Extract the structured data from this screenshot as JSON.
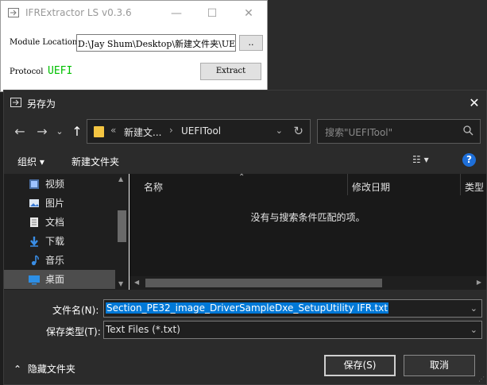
{
  "bg_window": {
    "title": "IFRExtractor LS v0.3.6",
    "module_label": "Module Location",
    "path_value": "D:\\Jay Shum\\Desktop\\新建文件夹\\UEF",
    "browse_label": "..",
    "protocol_label": "Protocol",
    "protocol_value": "UEFI",
    "extract_label": "Extract",
    "minimize": "—",
    "maximize": "☐",
    "close": "✕"
  },
  "dialog": {
    "title": "另存为",
    "close": "✕",
    "nav": {
      "back": "←",
      "forward": "→",
      "recent": "⌄",
      "up": "↑",
      "breadcrumb_prefix": "«",
      "crumb1": "新建文...",
      "crumb_sep": "›",
      "crumb2": "UEFITool",
      "search_placeholder": "搜索\"UEFITool\"",
      "refresh": "↻",
      "dropdown": "⌄"
    },
    "toolbar": {
      "organize": "组织 ▾",
      "new_folder": "新建文件夹",
      "view": "☷ ▾",
      "help": "?"
    },
    "nav_pane": {
      "items": [
        {
          "label": "视频",
          "icon": "video-icon"
        },
        {
          "label": "图片",
          "icon": "pictures-icon"
        },
        {
          "label": "文档",
          "icon": "documents-icon"
        },
        {
          "label": "下载",
          "icon": "download-icon"
        },
        {
          "label": "音乐",
          "icon": "music-icon"
        },
        {
          "label": "桌面",
          "icon": "desktop-icon"
        }
      ]
    },
    "file_pane": {
      "columns": [
        "名称",
        "修改日期",
        "类型"
      ],
      "empty_message": "没有与搜索条件匹配的项。"
    },
    "bottom": {
      "filename_label": "文件名(N):",
      "filename_value": "Section_PE32_image_DriverSampleDxe_SetupUtility IFR.txt",
      "filetype_label": "保存类型(T):",
      "filetype_value": "Text Files (*.txt)",
      "hide_folders": "隐藏文件夹",
      "save": "保存(S)",
      "cancel": "取消"
    }
  },
  "colors": {
    "accent": "#0078d7",
    "protocol_green": "#00c000",
    "dark_bg": "#2b2b2b"
  }
}
